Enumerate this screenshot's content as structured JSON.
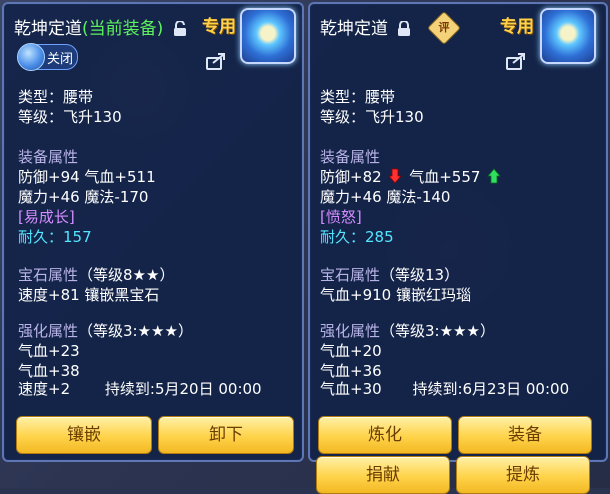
{
  "left": {
    "title_name": "乾坤定道",
    "title_status": "(当前装备)",
    "special_label": "专用",
    "toggle_label": "关闭",
    "type_line": "类型：腰带",
    "level_line": "等级：飞升130",
    "attr_header": "装备属性",
    "attr_line1": "防御+94 气血+511",
    "attr_line2": "魔力+46 魔法-170",
    "special_effect": "[易成长]",
    "durability_label": "耐久：",
    "durability_value": "157",
    "gem_header": "宝石属性",
    "gem_level": "（等级8★★）",
    "gem_line": "速度+81 镶嵌黑宝石",
    "enhance_header": "强化属性",
    "enhance_level": "（等级3:★★★）",
    "enhance_line1": "气血+23",
    "enhance_line2": "气血+38",
    "enhance_line3": "速度+2",
    "enhance_duration": "持续到:5月20日 00:00",
    "buttons": [
      "镶嵌",
      "卸下"
    ]
  },
  "right": {
    "title_name": "乾坤定道",
    "special_label": "专用",
    "seal_label": "评",
    "type_line": "类型：腰带",
    "level_line": "等级：飞升130",
    "attr_header": "装备属性",
    "attr_defense": "防御+82",
    "attr_hp": "气血+557",
    "attr_line2": "魔力+46 魔法-140",
    "special_effect": "[愤怒]",
    "durability_label": "耐久：",
    "durability_value": "285",
    "gem_header": "宝石属性",
    "gem_level": "（等级13）",
    "gem_line": "气血+910 镶嵌红玛瑙",
    "enhance_header": "强化属性",
    "enhance_level": "（等级3:★★★）",
    "enhance_line1": "气血+20",
    "enhance_line2": "气血+36",
    "enhance_line3": "气血+30",
    "enhance_duration": "持续到:6月23日 00:00",
    "buttons": [
      "炼化",
      "装备",
      "捐献",
      "提炼"
    ]
  },
  "colors": {
    "title_green": "#5cf25c",
    "section": "#b9b4e8",
    "special_effect": "#d58cff",
    "durability": "#54e6ff",
    "button_text": "#6b3d00",
    "arrow_down": "#ff3030",
    "arrow_up": "#30e060"
  },
  "icons": {
    "lock_open": "unlocked-lock-icon",
    "lock_closed": "locked-lock-icon",
    "share": "share-icon",
    "item": "belt-item-icon",
    "arrow_down": "decrease-arrow-icon",
    "arrow_up": "increase-arrow-icon"
  }
}
